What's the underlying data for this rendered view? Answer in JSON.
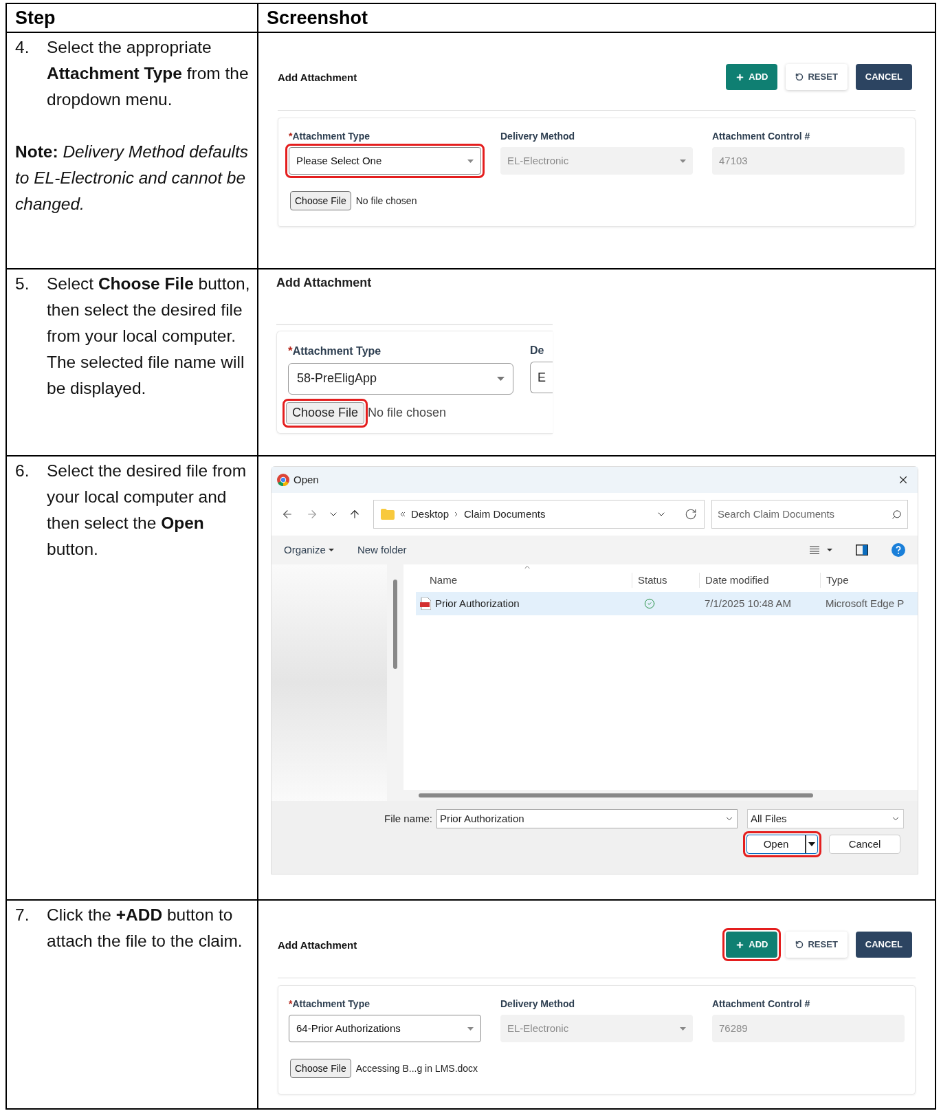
{
  "table": {
    "columns": [
      "Step",
      "Screenshot"
    ],
    "rows": [
      {
        "number": "4.",
        "text": "Select the appropriate **Attachment Type** from the dropdown menu.",
        "note": "**Note:** *Delivery Method defaults to EL-Electronic and cannot be changed.*",
        "screenshot": {
          "kind": "form",
          "title": "Add Attachment",
          "buttons": [
            {
              "kind": "add",
              "label": "ADD",
              "highlighted": false
            },
            {
              "kind": "reset",
              "label": "RESET",
              "highlighted": false
            },
            {
              "kind": "cancel",
              "label": "CANCEL",
              "highlighted": false
            }
          ],
          "fields": [
            {
              "kind": "select",
              "marker": "*",
              "label": "Attachment Type",
              "value": "Please Select One",
              "disabled": false,
              "highlighted": true
            },
            {
              "kind": "select",
              "label": "Delivery Method",
              "value": "EL-Electronic",
              "disabled": true,
              "highlighted": false
            },
            {
              "kind": "text",
              "label": "Attachment Control #",
              "value": "47103",
              "disabled": true,
              "highlighted": false
            }
          ],
          "file": {
            "button": "Choose File",
            "status": "No file chosen",
            "highlighted": false
          }
        }
      },
      {
        "number": "5.",
        "text": "Select **Choose File** button, then select the desired file from your local computer. The selected file name will be displayed.",
        "screenshot": {
          "kind": "form_zoomed",
          "title": "Add Attachment",
          "fields": [
            {
              "marker": "*",
              "label": "Attachment Type",
              "value": "58-PreEligApp",
              "disabled": false,
              "highlighted": false
            },
            {
              "label": "De",
              "value": "E",
              "disabled": false,
              "highlighted": false
            }
          ],
          "file": {
            "button": "Choose File",
            "status": "No file chosen",
            "highlighted": true
          }
        }
      },
      {
        "number": "6.",
        "text": "Select the desired file from your local computer and then select the **Open** button.",
        "screenshot": {
          "kind": "file_dialog",
          "title": "Open",
          "path": [
            "Desktop",
            "Claim Documents"
          ],
          "search_placeholder": "Search Claim Documents",
          "toolbar": [
            "Organize",
            "New folder"
          ],
          "columns": [
            "Name",
            "Status",
            "Date modified",
            "Type"
          ],
          "files": [
            {
              "name": "Prior Authorization",
              "synced": true,
              "date": "7/1/2025 10:48 AM",
              "type": "Microsoft Edge P",
              "selected": true
            }
          ],
          "file_name_label": "File name:",
          "file_name": "Prior Authorization",
          "filter": "All Files",
          "buttons": [
            {
              "kind": "open",
              "label": "Open",
              "highlighted": true
            },
            {
              "kind": "cancel",
              "label": "Cancel",
              "highlighted": false
            }
          ]
        }
      },
      {
        "number": "7.",
        "text": "Click the **+ADD** button to attach the file to the claim.",
        "screenshot": {
          "kind": "form",
          "title": "Add Attachment",
          "buttons": [
            {
              "kind": "add",
              "label": "ADD",
              "highlighted": true
            },
            {
              "kind": "reset",
              "label": "RESET",
              "highlighted": false
            },
            {
              "kind": "cancel",
              "label": "CANCEL",
              "highlighted": false
            }
          ],
          "fields": [
            {
              "kind": "select",
              "marker": "*",
              "label": "Attachment Type",
              "value": "64-Prior Authorizations",
              "disabled": false,
              "highlighted": false
            },
            {
              "kind": "select",
              "label": "Delivery Method",
              "value": "EL-Electronic",
              "disabled": true,
              "highlighted": false
            },
            {
              "kind": "text",
              "label": "Attachment Control #",
              "value": "76289",
              "disabled": true,
              "highlighted": false
            }
          ],
          "file": {
            "button": "Choose File",
            "status": "Accessing B...g in LMS.docx",
            "highlighted": false
          }
        }
      }
    ]
  }
}
